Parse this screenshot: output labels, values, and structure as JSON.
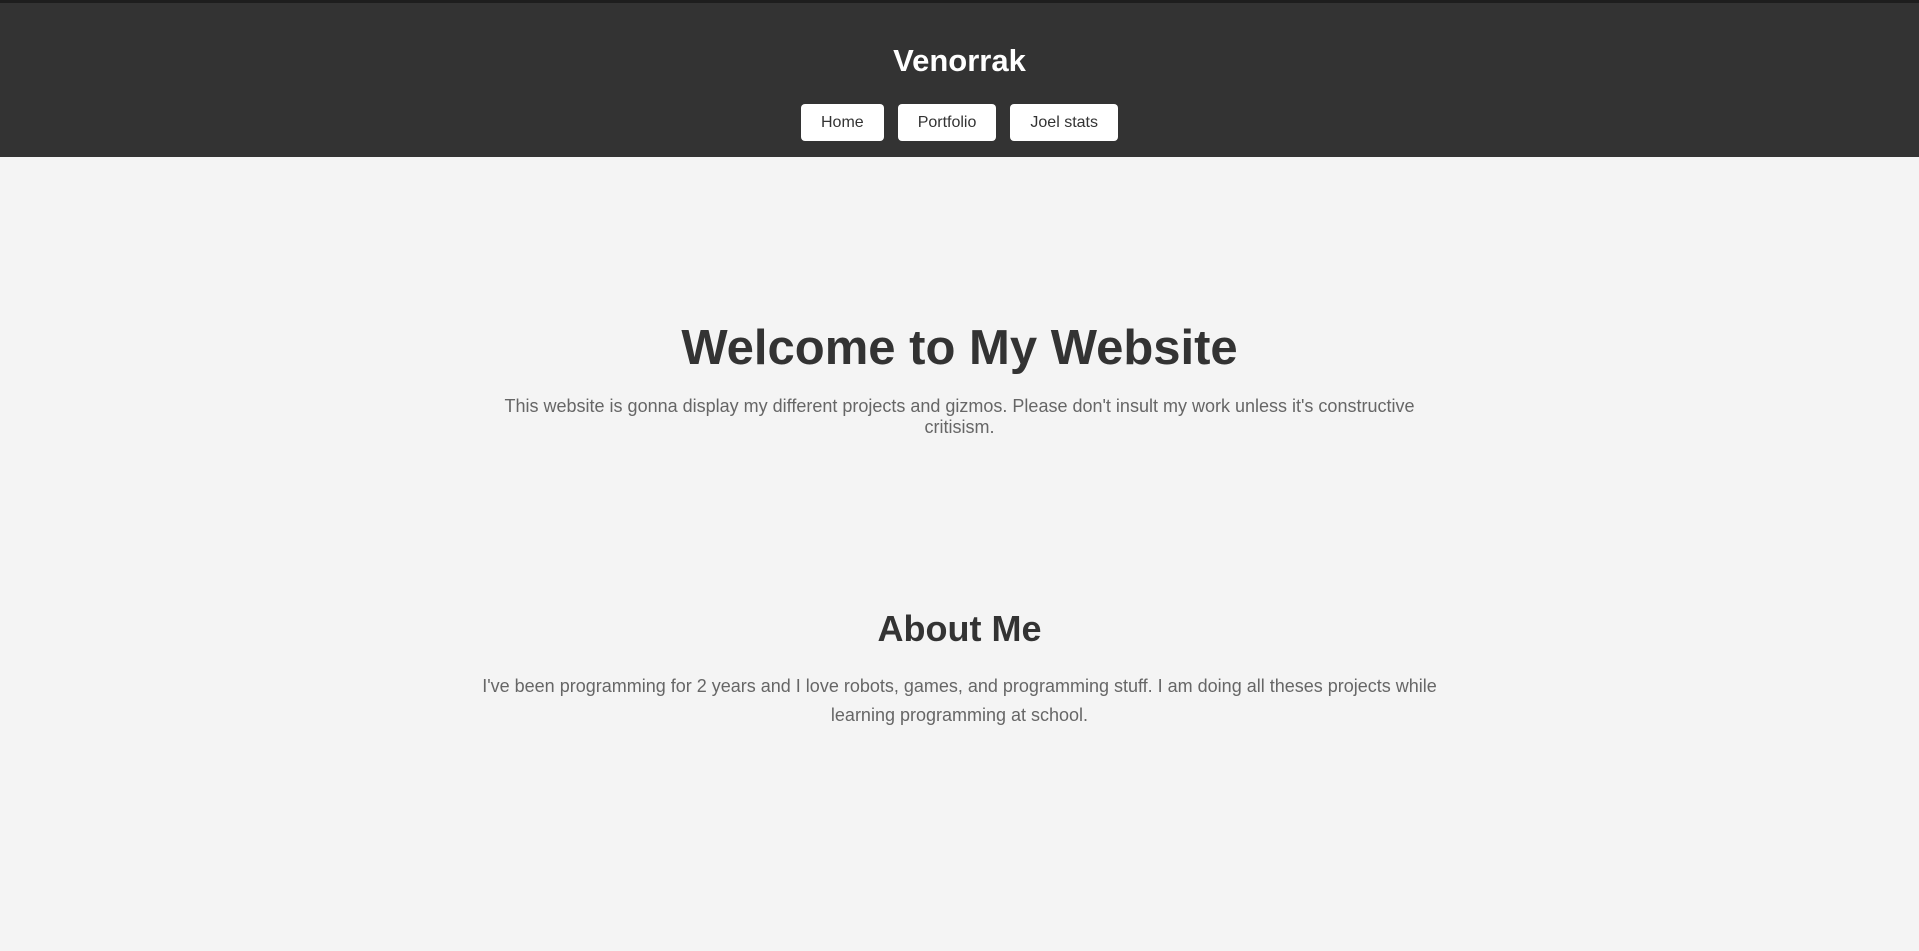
{
  "header": {
    "title": "Venorrak",
    "nav": [
      {
        "label": "Home"
      },
      {
        "label": "Portfolio"
      },
      {
        "label": "Joel stats"
      }
    ]
  },
  "hero": {
    "title": "Welcome to My Website",
    "text": "This website is gonna display my different projects and gizmos. Please don't insult my work unless it's constructive critisism."
  },
  "about": {
    "title": "About Me",
    "text": "I've been programming for 2 years and I love robots, games, and programming stuff. I am doing all theses projects while learning programming at school."
  },
  "colors": {
    "header_bg": "#333333",
    "page_bg": "#f4f4f4",
    "heading": "#333333",
    "body_text": "#666666"
  }
}
